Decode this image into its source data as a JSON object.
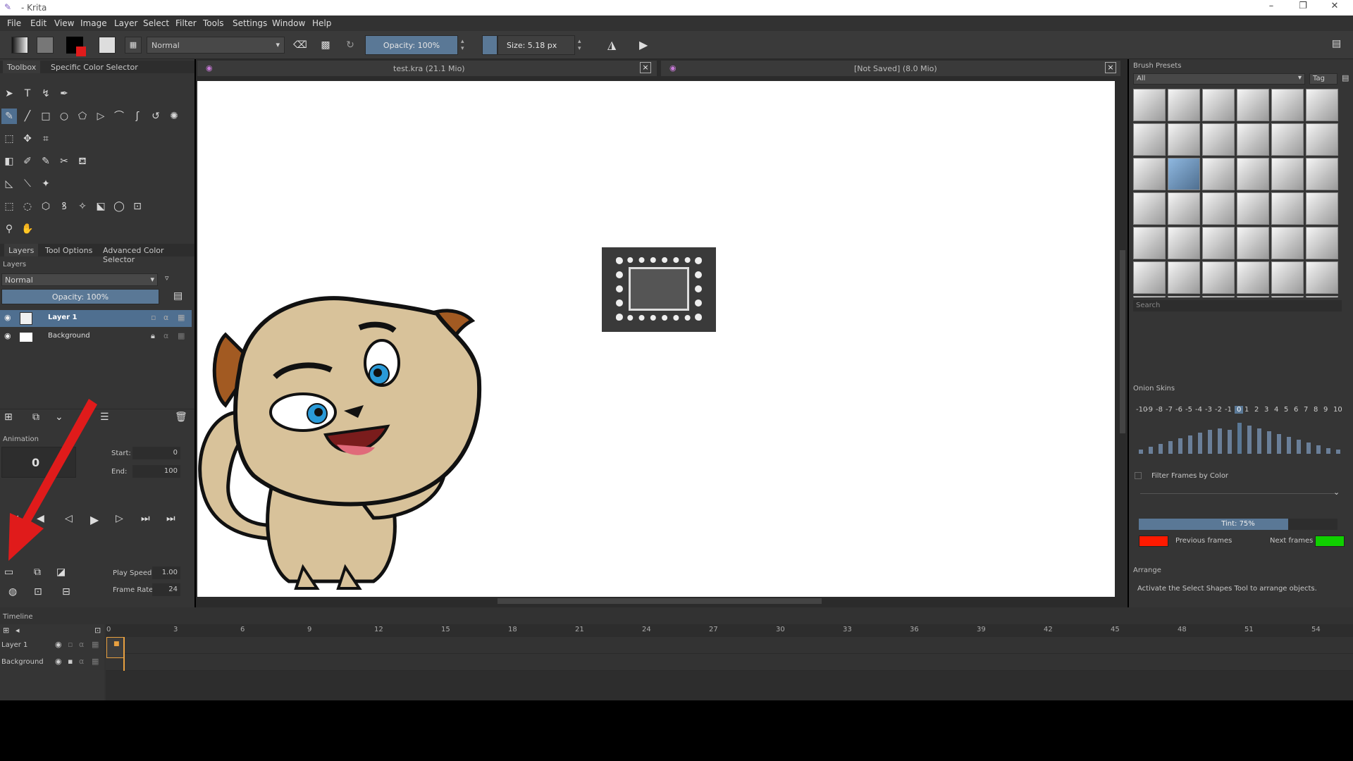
{
  "window": {
    "title": " - Krita",
    "minimize": "–",
    "maximize": "❐",
    "close": "✕"
  },
  "menu": [
    "File",
    "Edit",
    "View",
    "Image",
    "Layer",
    "Select",
    "Filter",
    "Tools",
    "Settings",
    "Window",
    "Help"
  ],
  "toolbar": {
    "blend_mode": "Normal",
    "opacity": "Opacity: 100%",
    "size": "Size: 5.18 px"
  },
  "toolbox": {
    "tabs": [
      "Toolbox",
      "Specific Color Selector"
    ]
  },
  "documents": [
    {
      "title": "test.kra (21.1 Mio)",
      "close": "×"
    },
    {
      "title": "[Not Saved]  (8.0 Mio)",
      "close": "×"
    }
  ],
  "layers_panel": {
    "tabs": [
      "Layers",
      "Tool Options",
      "Advanced Color Selector"
    ],
    "header": "Layers",
    "blend_mode": "Normal",
    "opacity": "Opacity:  100%",
    "layers": [
      {
        "name": "Layer 1",
        "selected": true
      },
      {
        "name": "Background",
        "selected": false
      }
    ]
  },
  "animation": {
    "header": "Animation",
    "current_frame": "0",
    "start_label": "Start:",
    "start": "0",
    "end_label": "End:",
    "end": "100",
    "play_speed_label": "Play Speed:",
    "play_speed": "1.00",
    "frame_rate_label": "Frame Rate:",
    "frame_rate": "24"
  },
  "brush_presets": {
    "header": "Brush Presets",
    "filter": "All",
    "tag": "Tag",
    "search_placeholder": "Search"
  },
  "onion_skins": {
    "header": "Onion Skins",
    "frames": [
      "-10",
      "-9",
      "-8",
      "-7",
      "-6",
      "-5",
      "-4",
      "-3",
      "-2",
      "-1",
      "0",
      "1",
      "2",
      "3",
      "4",
      "5",
      "6",
      "7",
      "8",
      "9",
      "10"
    ],
    "filter_label": "Filter Frames by Color",
    "tint": "Tint: 75%",
    "tint_fraction": 0.75,
    "previous_label": "Previous frames",
    "next_label": "Next frames",
    "previous_color": "#ff1a00",
    "next_color": "#10d000"
  },
  "arrange": {
    "header": "Arrange",
    "text": "Activate the Select Shapes Tool to arrange objects."
  },
  "timeline": {
    "header": "Timeline",
    "frame_numbers": [
      "0",
      "3",
      "6",
      "9",
      "12",
      "15",
      "18",
      "21",
      "24",
      "27",
      "30",
      "33",
      "36",
      "39",
      "42",
      "45",
      "48",
      "51",
      "54"
    ],
    "layers": [
      "Layer 1",
      "Background"
    ]
  },
  "colors": {
    "accent": "#4f6f90",
    "panel": "#353535",
    "arrow": "#e01b1b"
  }
}
